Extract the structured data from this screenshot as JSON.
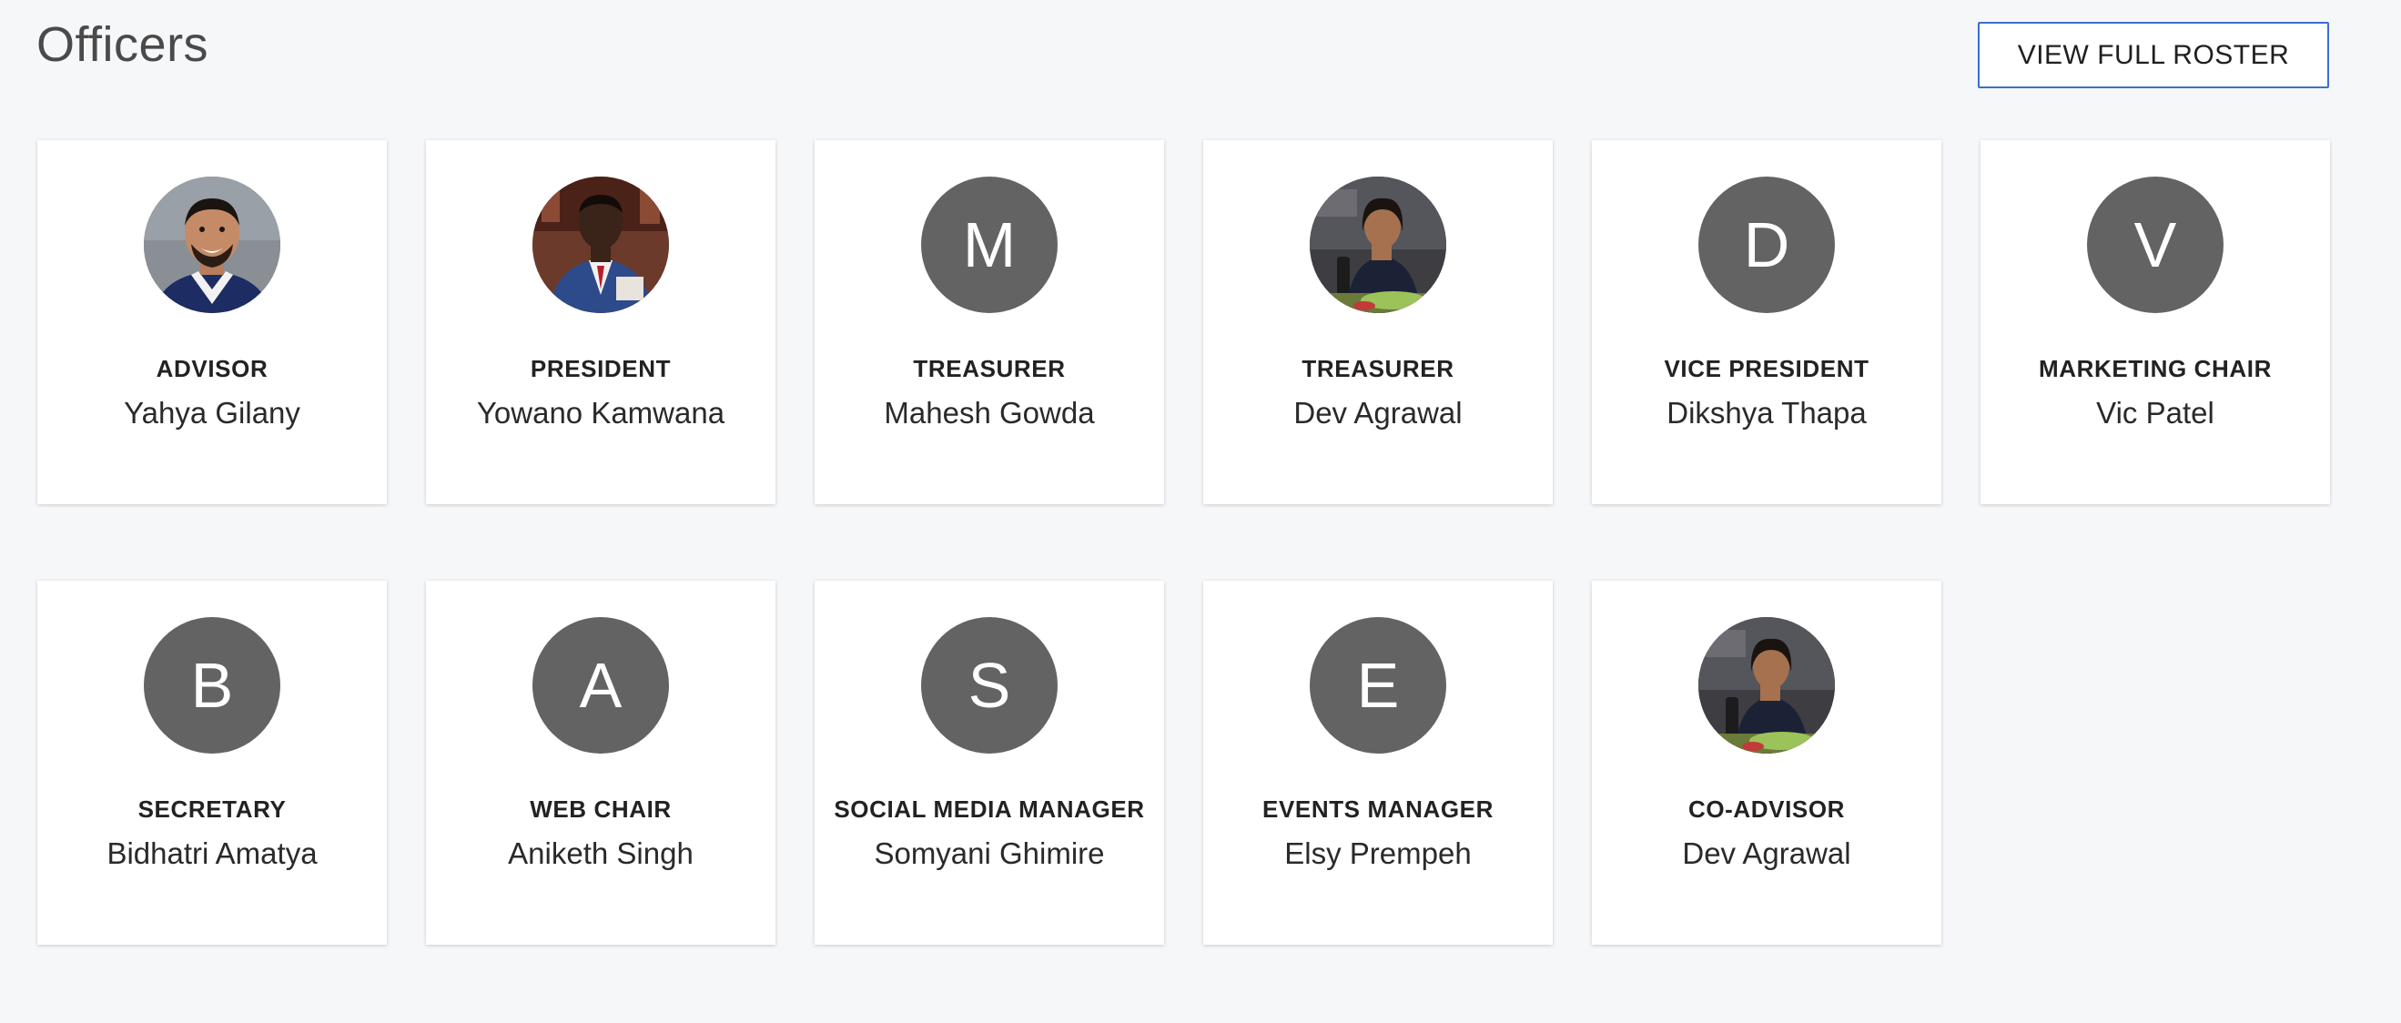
{
  "header": {
    "title": "Officers",
    "roster_button": "VIEW FULL ROSTER"
  },
  "officers": [
    {
      "role": "ADVISOR",
      "name": "Yahya Gilany",
      "avatar": {
        "type": "photo",
        "icon": "person-photo-blue-shirt"
      }
    },
    {
      "role": "PRESIDENT",
      "name": "Yowano Kamwana",
      "avatar": {
        "type": "photo",
        "icon": "person-photo-blue-suit"
      }
    },
    {
      "role": "TREASURER",
      "name": "Mahesh Gowda",
      "avatar": {
        "type": "initial",
        "initial": "M"
      }
    },
    {
      "role": "TREASURER",
      "name": "Dev Agrawal",
      "avatar": {
        "type": "photo",
        "icon": "person-photo-desk"
      }
    },
    {
      "role": "VICE PRESIDENT",
      "name": "Dikshya Thapa",
      "avatar": {
        "type": "initial",
        "initial": "D"
      }
    },
    {
      "role": "MARKETING CHAIR",
      "name": "Vic Patel",
      "avatar": {
        "type": "initial",
        "initial": "V"
      }
    },
    {
      "role": "SECRETARY",
      "name": "Bidhatri Amatya",
      "avatar": {
        "type": "initial",
        "initial": "B"
      }
    },
    {
      "role": "WEB CHAIR",
      "name": "Aniketh Singh",
      "avatar": {
        "type": "initial",
        "initial": "A"
      }
    },
    {
      "role": "SOCIAL MEDIA MANAGER",
      "name": "Somyani Ghimire",
      "avatar": {
        "type": "initial",
        "initial": "S"
      }
    },
    {
      "role": "EVENTS MANAGER",
      "name": "Elsy Prempeh",
      "avatar": {
        "type": "initial",
        "initial": "E"
      }
    },
    {
      "role": "CO-ADVISOR",
      "name": "Dev Agrawal",
      "avatar": {
        "type": "photo",
        "icon": "person-photo-desk"
      }
    }
  ],
  "colors": {
    "background": "#f6f7f9",
    "card": "#ffffff",
    "avatar_placeholder": "#636363",
    "button_border": "#3b6fd1"
  }
}
